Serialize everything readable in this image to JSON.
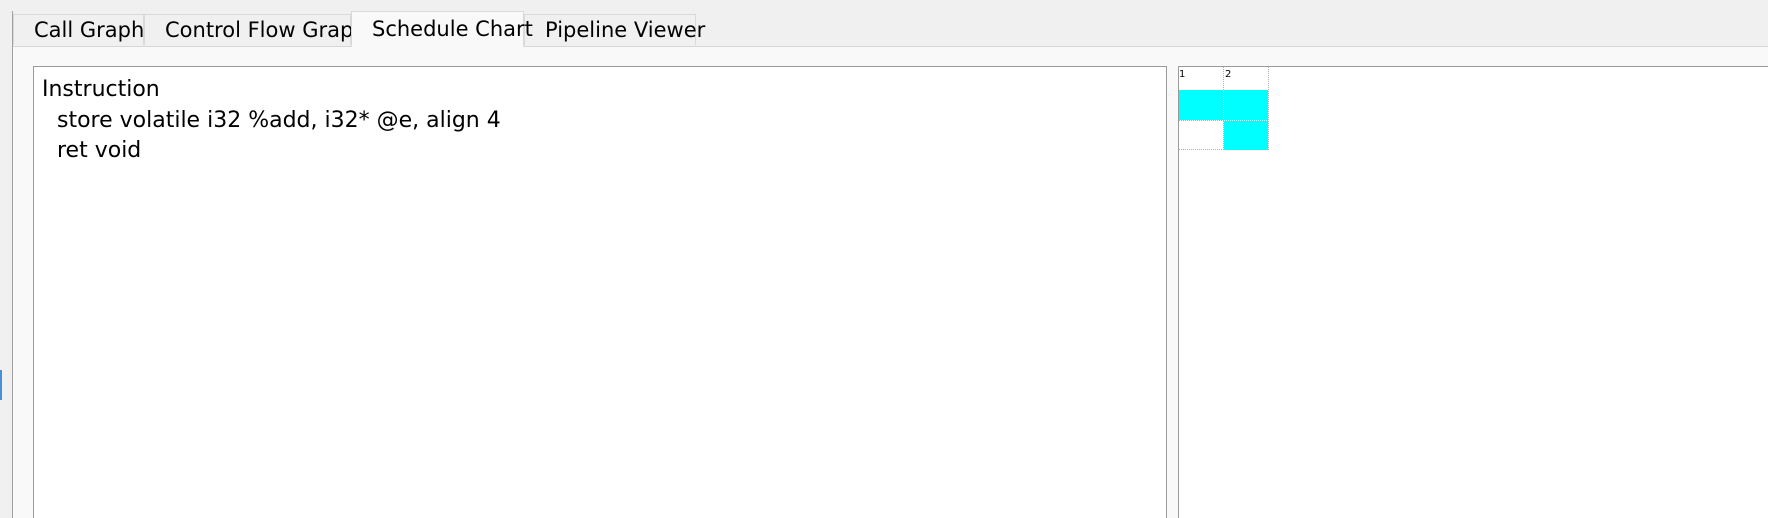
{
  "tabs": [
    {
      "label": "Call Graph",
      "active": false
    },
    {
      "label": "Control Flow Graph",
      "active": false
    },
    {
      "label": "Schedule Chart",
      "active": true
    },
    {
      "label": "Pipeline Viewer",
      "active": false
    }
  ],
  "instruction_panel": {
    "header": "Instruction",
    "rows": [
      "store volatile i32 %add, i32* @e, align 4",
      "ret void"
    ]
  },
  "schedule_chart": {
    "cycle_labels": [
      "1",
      "2"
    ],
    "cell_color": "#00ffff",
    "scheduled_cycles": [
      {
        "instruction": "store volatile i32 %add, i32* @e, align 4",
        "cycles": [
          "1",
          "2"
        ]
      },
      {
        "instruction": "ret void",
        "cycles": [
          "2"
        ]
      }
    ]
  }
}
